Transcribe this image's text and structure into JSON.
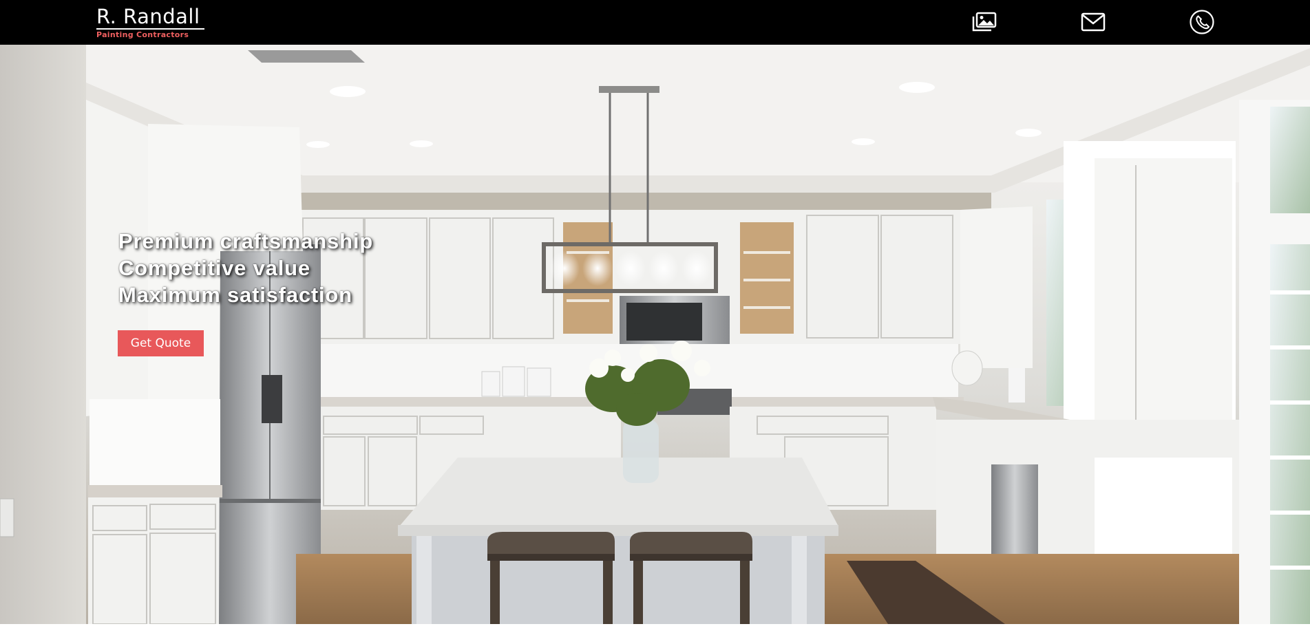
{
  "brand": {
    "name": "R. Randall",
    "tagline": "Painting Contractors"
  },
  "header": {
    "icons": [
      {
        "name": "gallery-icon"
      },
      {
        "name": "mail-icon"
      },
      {
        "name": "phone-icon"
      }
    ]
  },
  "hero": {
    "lines": [
      "Premium craftsmanship",
      "Competitive value",
      "Maximum satisfaction"
    ],
    "cta_label": "Get Quote"
  },
  "colors": {
    "header_bg": "#000000",
    "accent": "#e8585a",
    "logo_tagline": "#f06060"
  }
}
